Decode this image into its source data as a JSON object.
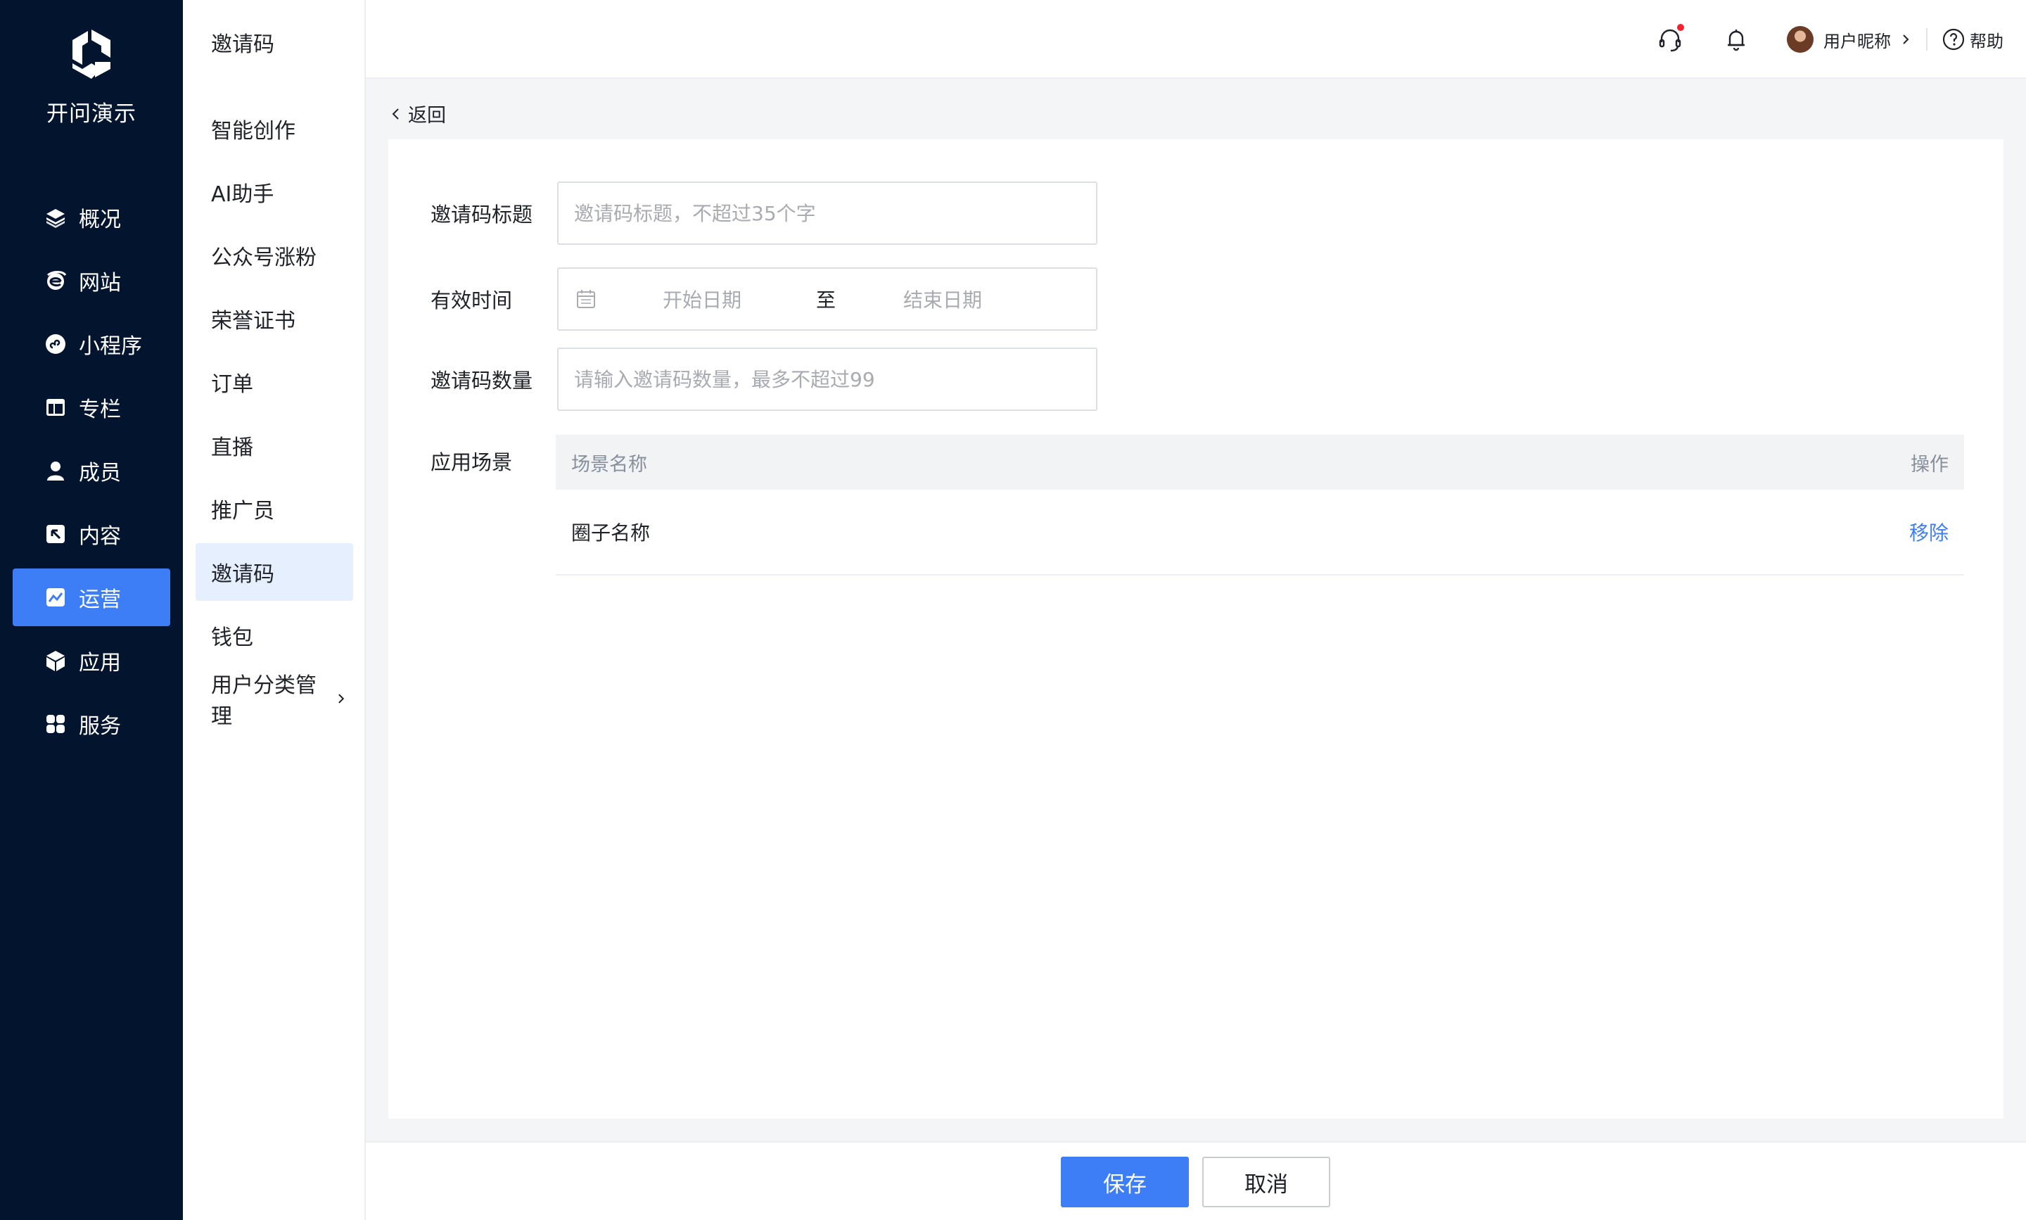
{
  "brand": {
    "name": "开问演示",
    "logo_icon": "brand-logo-icon"
  },
  "nav": {
    "items": [
      {
        "label": "概况",
        "icon": "layers-icon"
      },
      {
        "label": "网站",
        "icon": "browser-e-icon"
      },
      {
        "label": "小程序",
        "icon": "mini-program-icon"
      },
      {
        "label": "专栏",
        "icon": "column-layout-icon"
      },
      {
        "label": "成员",
        "icon": "person-icon"
      },
      {
        "label": "内容",
        "icon": "content-arrow-icon"
      },
      {
        "label": "运营",
        "icon": "chart-line-icon",
        "active": true
      },
      {
        "label": "应用",
        "icon": "cube-icon"
      },
      {
        "label": "服务",
        "icon": "grid-apps-icon"
      }
    ]
  },
  "submenu": {
    "title": "邀请码",
    "items": [
      {
        "label": "智能创作"
      },
      {
        "label": "AI助手"
      },
      {
        "label": "公众号涨粉"
      },
      {
        "label": "荣誉证书"
      },
      {
        "label": "订单"
      },
      {
        "label": "直播"
      },
      {
        "label": "推广员"
      },
      {
        "label": "邀请码",
        "active": true
      },
      {
        "label": "钱包"
      },
      {
        "label": "用户分类管理",
        "has_children": true
      }
    ]
  },
  "header": {
    "user_name": "用户昵称",
    "help_label": "帮助",
    "icons": [
      "headset-icon",
      "bell-icon",
      "chevron-right-icon",
      "question-circle-icon"
    ]
  },
  "back_label": "返回",
  "form": {
    "title": {
      "label": "邀请码标题",
      "value": "",
      "placeholder": "邀请码标题，不超过35个字"
    },
    "period": {
      "label": "有效时间",
      "start_placeholder": "开始日期",
      "separator": "至",
      "end_placeholder": "结束日期"
    },
    "quantity": {
      "label": "邀请码数量",
      "value": "",
      "placeholder": "请输入邀请码数量，最多不超过99"
    },
    "scene": {
      "label": "应用场景",
      "columns": {
        "name": "场景名称",
        "action": "操作"
      },
      "rows": [
        {
          "name": "圈子名称",
          "action": "移除"
        }
      ]
    }
  },
  "footer": {
    "save_label": "保存",
    "cancel_label": "取消"
  },
  "colors": {
    "sidebar_bg": "#03152e",
    "accent": "#3d7ef6",
    "active_submenu_bg": "#e6effe",
    "page_bg": "#f4f5f7"
  }
}
